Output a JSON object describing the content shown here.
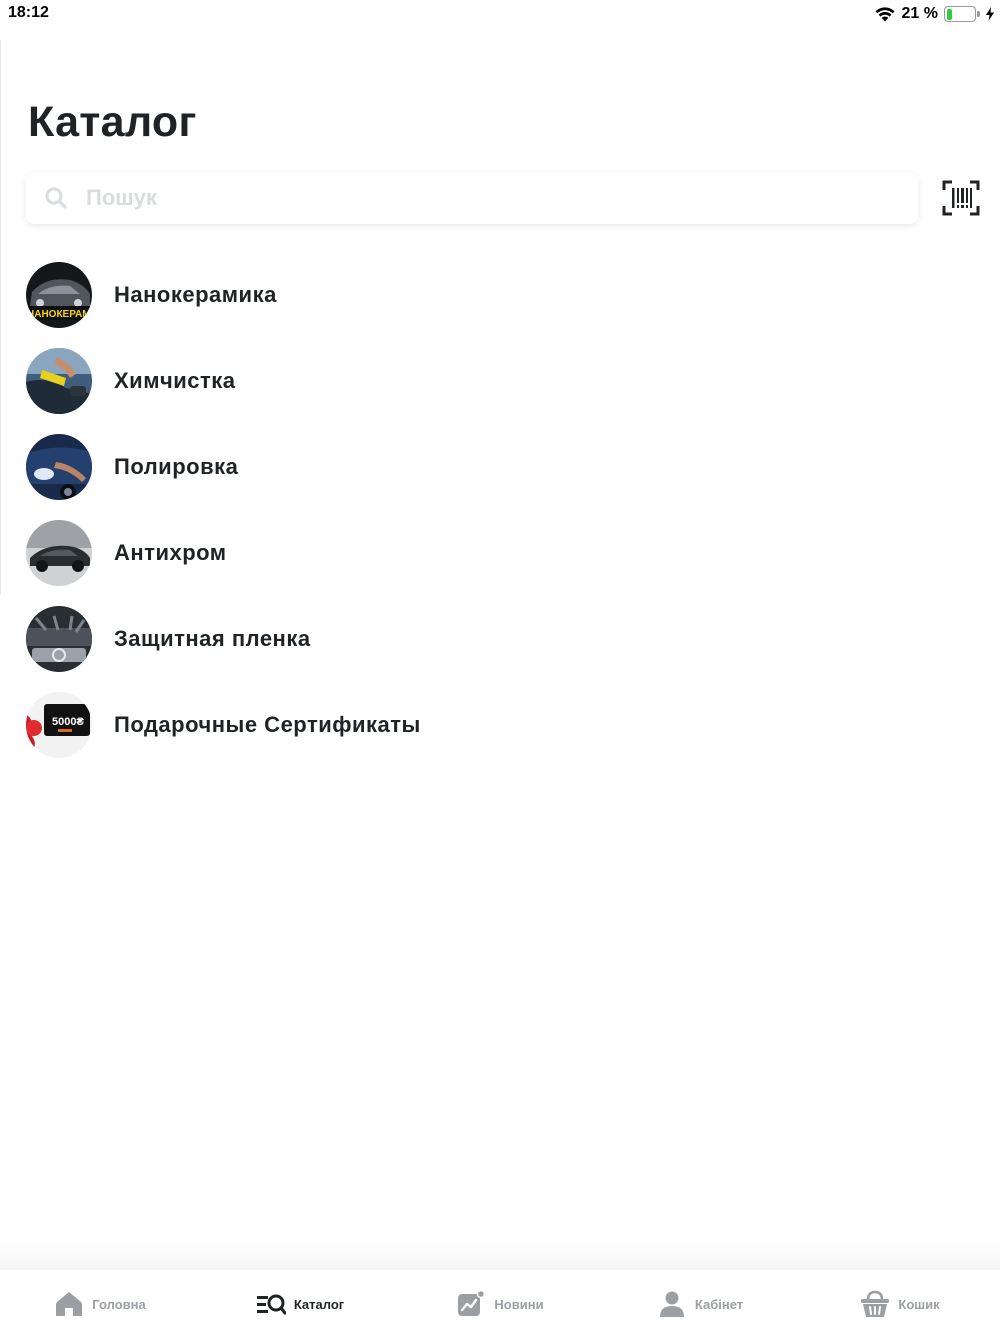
{
  "status_bar": {
    "time": "18:12",
    "battery_percent": "21 %",
    "battery_level": 0.21
  },
  "page": {
    "title": "Каталог"
  },
  "search": {
    "placeholder": "Пошук",
    "value": ""
  },
  "barcode": {
    "icon": "barcode-scan-icon"
  },
  "categories": [
    {
      "label": "Нанокерамика",
      "thumb_text": "НАНОКЕРАМИ"
    },
    {
      "label": "Химчистка"
    },
    {
      "label": "Полировка"
    },
    {
      "label": "Антихром"
    },
    {
      "label": "Защитная пленка"
    },
    {
      "label": "Подарочные Сертификаты",
      "thumb_text": "5000₴"
    }
  ],
  "tabs": [
    {
      "label": "Головна",
      "icon": "home-icon",
      "active": false
    },
    {
      "label": "Каталог",
      "icon": "catalog-search-icon",
      "active": true
    },
    {
      "label": "Новини",
      "icon": "news-chart-icon",
      "active": false
    },
    {
      "label": "Кабінет",
      "icon": "user-icon",
      "active": false
    },
    {
      "label": "Кошик",
      "icon": "basket-icon",
      "active": false
    }
  ],
  "colors": {
    "text": "#1f2326",
    "tab_inactive": "#9b9fa3",
    "battery_green": "#2fcc41",
    "placeholder": "#d9dcde"
  }
}
